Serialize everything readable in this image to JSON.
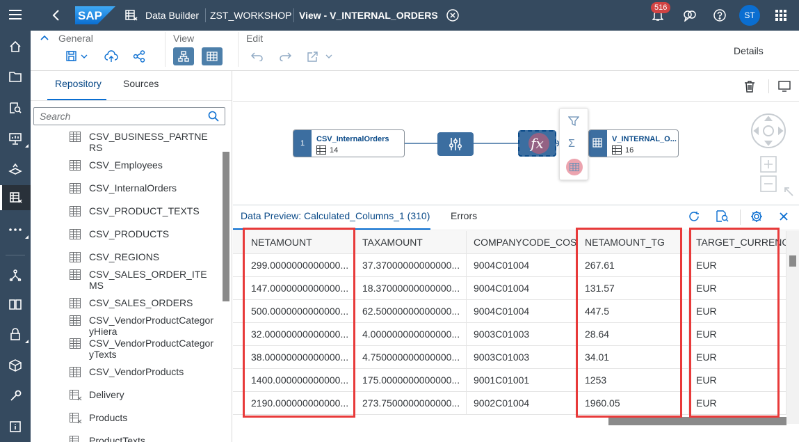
{
  "shell": {
    "brand": "SAP",
    "app_name": "Data Builder",
    "space": "ZST_WORKSHOP",
    "view_title": "View - V_INTERNAL_ORDERS",
    "notifications": "516",
    "avatar_initials": "ST",
    "bg_color": "#354a5f"
  },
  "rail": {
    "icons": [
      "menu-icon",
      "home-icon",
      "folder-icon",
      "data-search-icon",
      "presentation-icon",
      "geo-icon",
      "data-builder-icon",
      "more-icon",
      "network-icon",
      "book-icon",
      "lock-icon",
      "package-icon",
      "wrench-icon",
      "info-icon"
    ]
  },
  "toolbar": {
    "general_label": "General",
    "view_label": "View",
    "edit_label": "Edit",
    "details_label": "Details"
  },
  "left_panel": {
    "tabs": [
      "Repository",
      "Sources"
    ],
    "active_tab": "Repository",
    "search_placeholder": "Search",
    "items": [
      {
        "label": "CSV_BUSINESS_PARTNERS",
        "icon": "table-icon"
      },
      {
        "label": "CSV_Employees",
        "icon": "table-icon"
      },
      {
        "label": "CSV_InternalOrders",
        "icon": "table-icon"
      },
      {
        "label": "CSV_PRODUCT_TEXTS",
        "icon": "table-icon"
      },
      {
        "label": "CSV_PRODUCTS",
        "icon": "table-icon"
      },
      {
        "label": "CSV_REGIONS",
        "icon": "table-icon"
      },
      {
        "label": "CSV_SALES_ORDER_ITEMS",
        "icon": "table-icon"
      },
      {
        "label": "CSV_SALES_ORDERS",
        "icon": "table-icon"
      },
      {
        "label": "CSV_VendorProductCategoryHiera",
        "icon": "table-icon"
      },
      {
        "label": "CSV_VendorProductCategoryTexts",
        "icon": "table-icon"
      },
      {
        "label": "CSV_VendorProducts",
        "icon": "table-icon"
      },
      {
        "label": "Delivery",
        "icon": "view-icon"
      },
      {
        "label": "Products",
        "icon": "view-icon"
      },
      {
        "label": "ProductTexts",
        "icon": "view-icon"
      }
    ]
  },
  "canvas": {
    "source_node": {
      "index": "1",
      "name": "CSV_InternalOrders",
      "count": "14"
    },
    "target_node": {
      "name": "V_INTERNAL_O...",
      "count": "16"
    },
    "ops": [
      "projection-icon",
      "calculated-column-icon"
    ],
    "context_menu": [
      "filter-icon",
      "sum-icon",
      "table-preview-icon"
    ]
  },
  "preview": {
    "title": "Data Preview: Calculated_Columns_1 (310)",
    "errors_tab": "Errors",
    "columns": [
      "NETAMOUNT",
      "TAXAMOUNT",
      "COMPANYCODE_COS",
      "NETAMOUNT_TG",
      "TARGET_CURRENCY"
    ],
    "rows": [
      [
        "299.0000000000000...",
        "37.37000000000000...",
        "9004C01004",
        "267.61",
        "EUR"
      ],
      [
        "147.0000000000000...",
        "18.37000000000000...",
        "9004C01004",
        "131.57",
        "EUR"
      ],
      [
        "500.0000000000000...",
        "62.50000000000000...",
        "9004C01004",
        "447.5",
        "EUR"
      ],
      [
        "32.00000000000000...",
        "4.000000000000000...",
        "9003C01003",
        "28.64",
        "EUR"
      ],
      [
        "38.00000000000000...",
        "4.750000000000000...",
        "9003C01003",
        "34.01",
        "EUR"
      ],
      [
        "1400.000000000000...",
        "175.0000000000000...",
        "9001C01001",
        "1253",
        "EUR"
      ],
      [
        "2190.000000000000...",
        "273.7500000000000...",
        "9002C01004",
        "1960.05",
        "EUR"
      ]
    ],
    "highlight_color": "#e83a3a",
    "accent_color": "#0a6ed1"
  }
}
